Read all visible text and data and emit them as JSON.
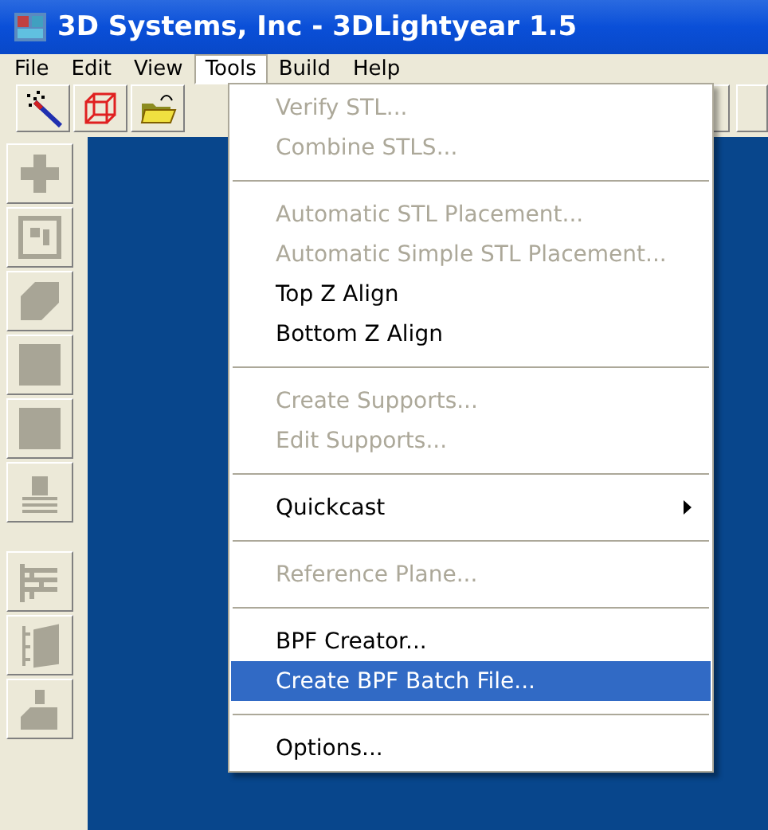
{
  "window": {
    "title": "3D Systems, Inc - 3DLightyear 1.5"
  },
  "menu_bar": [
    {
      "label": "File",
      "selected": false
    },
    {
      "label": "Edit",
      "selected": false
    },
    {
      "label": "View",
      "selected": false
    },
    {
      "label": "Tools",
      "selected": true
    },
    {
      "label": "Build",
      "selected": false
    },
    {
      "label": "Help",
      "selected": false
    }
  ],
  "tools_menu": [
    {
      "kind": "item",
      "label": "Verify STL...",
      "disabled": true,
      "selected": false
    },
    {
      "kind": "item",
      "label": "Combine STLS...",
      "disabled": true,
      "selected": false
    },
    {
      "kind": "separator"
    },
    {
      "kind": "item",
      "label": "Automatic STL Placement...",
      "disabled": true,
      "selected": false
    },
    {
      "kind": "item",
      "label": "Automatic Simple STL Placement...",
      "disabled": true,
      "selected": false
    },
    {
      "kind": "item",
      "label": "Top Z Align",
      "disabled": false,
      "selected": false
    },
    {
      "kind": "item",
      "label": "Bottom Z Align",
      "disabled": false,
      "selected": false
    },
    {
      "kind": "separator"
    },
    {
      "kind": "item",
      "label": "Create Supports...",
      "disabled": true,
      "selected": false
    },
    {
      "kind": "item",
      "label": "Edit Supports...",
      "disabled": true,
      "selected": false
    },
    {
      "kind": "separator"
    },
    {
      "kind": "submenu",
      "label": "Quickcast",
      "disabled": false,
      "selected": false
    },
    {
      "kind": "separator"
    },
    {
      "kind": "item",
      "label": "Reference Plane...",
      "disabled": true,
      "selected": false
    },
    {
      "kind": "separator"
    },
    {
      "kind": "item",
      "label": "BPF Creator...",
      "disabled": false,
      "selected": false
    },
    {
      "kind": "item",
      "label": "Create BPF Batch File...",
      "disabled": false,
      "selected": true
    },
    {
      "kind": "separator"
    },
    {
      "kind": "item",
      "label": "Options...",
      "disabled": false,
      "selected": false
    }
  ]
}
